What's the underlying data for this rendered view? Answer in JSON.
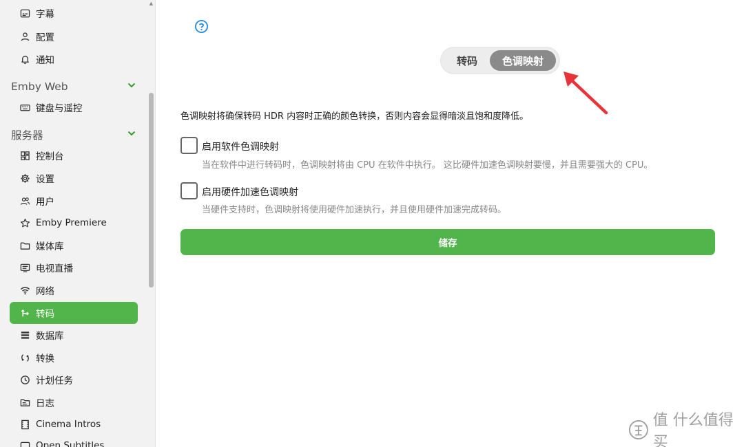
{
  "sidebar": {
    "items_top": [
      {
        "label": "字幕",
        "icon": "subtitles-icon"
      },
      {
        "label": "配置",
        "icon": "person-icon"
      },
      {
        "label": "通知",
        "icon": "bell-icon"
      }
    ],
    "section_web": {
      "title": "Emby Web"
    },
    "web_items": [
      {
        "label": "键盘与遥控",
        "icon": "keyboard-icon"
      }
    ],
    "section_server": {
      "title": "服务器"
    },
    "server_items": [
      {
        "label": "控制台",
        "icon": "dashboard-icon"
      },
      {
        "label": "设置",
        "icon": "gear-icon"
      },
      {
        "label": "用户",
        "icon": "people-icon"
      },
      {
        "label": "Emby Premiere",
        "icon": "star-icon"
      },
      {
        "label": "媒体库",
        "icon": "folder-icon"
      },
      {
        "label": "电视直播",
        "icon": "tv-guide-icon"
      },
      {
        "label": "网络",
        "icon": "wifi-icon"
      },
      {
        "label": "转码",
        "icon": "transcode-icon"
      },
      {
        "label": "数据库",
        "icon": "database-icon"
      },
      {
        "label": "转换",
        "icon": "convert-icon"
      },
      {
        "label": "计划任务",
        "icon": "clock-icon"
      },
      {
        "label": "日志",
        "icon": "log-folder-icon"
      },
      {
        "label": "Cinema Intros",
        "icon": "film-icon"
      },
      {
        "label": "Open Subtitles",
        "icon": "subtitles-icon"
      }
    ],
    "active_label": "转码"
  },
  "tabs": [
    {
      "label": "转码"
    },
    {
      "label": "色调映射"
    }
  ],
  "active_tab": "色调映射",
  "description": "色调映射将确保转码 HDR 内容时正确的颜色转换，否则内容会显得暗淡且饱和度降低。",
  "options": [
    {
      "label": "启用软件色调映射",
      "help": "当在软件中进行转码时，色调映射将由 CPU 在软件中执行。 这比硬件加速色调映射要慢，并且需要强大的 CPU。",
      "checked": false
    },
    {
      "label": "启用硬件加速色调映射",
      "help": "当硬件支持时，色调映射将使用硬件加速执行，并且使用硬件加速完成转码。",
      "checked": false
    }
  ],
  "save_label": "储存",
  "watermark": {
    "text": "值 什么值得买"
  },
  "colors": {
    "accent": "#52b54b",
    "annotation_arrow": "#e8333a",
    "tab_active": "#8a8a8a"
  }
}
